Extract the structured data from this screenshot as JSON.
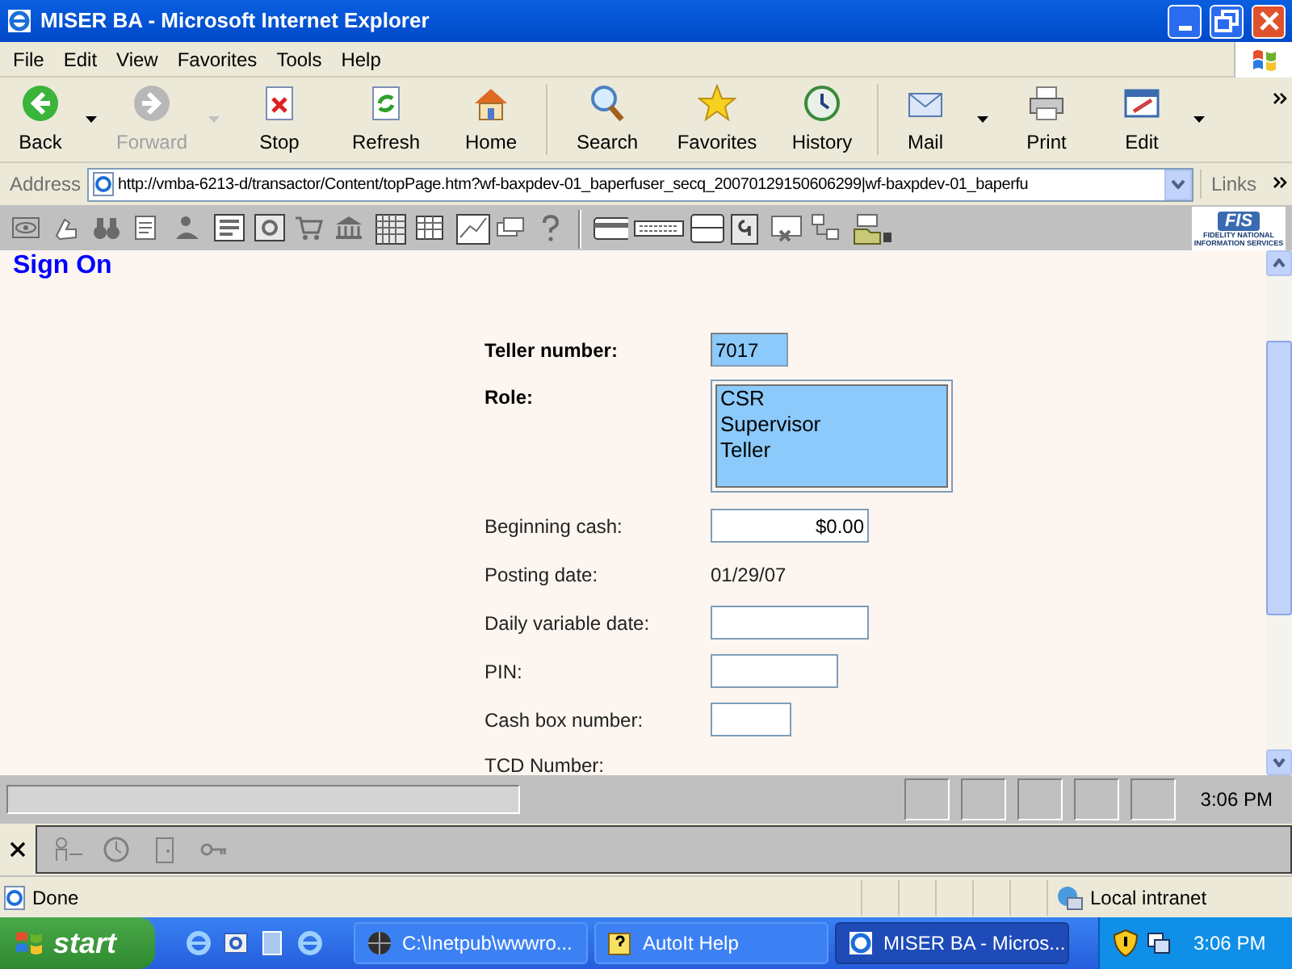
{
  "window": {
    "title": "MISER BA - Microsoft Internet Explorer"
  },
  "menu": [
    "File",
    "Edit",
    "View",
    "Favorites",
    "Tools",
    "Help"
  ],
  "toolbar": [
    {
      "kind": "back",
      "label": "Back",
      "disabled": false,
      "dropdown": true
    },
    {
      "kind": "forward",
      "label": "Forward",
      "disabled": true,
      "dropdown": true
    },
    {
      "kind": "stop",
      "label": "Stop",
      "disabled": false,
      "dropdown": false
    },
    {
      "kind": "refresh",
      "label": "Refresh",
      "disabled": false,
      "dropdown": false
    },
    {
      "kind": "home",
      "label": "Home",
      "disabled": false,
      "dropdown": false
    },
    {
      "kind": "search",
      "label": "Search",
      "disabled": false,
      "dropdown": false
    },
    {
      "kind": "favorites",
      "label": "Favorites",
      "disabled": false,
      "dropdown": false
    },
    {
      "kind": "history",
      "label": "History",
      "disabled": false,
      "dropdown": false
    },
    {
      "kind": "mail",
      "label": "Mail",
      "disabled": false,
      "dropdown": true
    },
    {
      "kind": "print",
      "label": "Print",
      "disabled": false,
      "dropdown": false
    },
    {
      "kind": "edit",
      "label": "Edit",
      "disabled": false,
      "dropdown": true
    }
  ],
  "address": {
    "label": "Address",
    "url": "http://vmba-6213-d/transactor/Content/topPage.htm?wf-baxpdev-01_baperfuser_secq_20070129150606299|wf-baxpdev-01_baperfu",
    "links": "Links"
  },
  "logo": {
    "text": "FIS",
    "tagline": [
      "FIDELITY NATIONAL",
      "INFORMATION SERVICES"
    ]
  },
  "page": {
    "heading": "Sign On",
    "fields": [
      {
        "kind": "input",
        "label": "Teller number:",
        "bold": true,
        "value": "7017",
        "highlighted": true
      },
      {
        "kind": "listbox",
        "label": "Role:",
        "bold": true,
        "options": [
          "CSR",
          "Supervisor",
          "Teller"
        ],
        "highlighted": true
      },
      {
        "kind": "input",
        "label": "Beginning cash:",
        "bold": false,
        "value": "$0.00",
        "highlighted": false
      },
      {
        "kind": "text",
        "label": "Posting date:",
        "bold": false,
        "value": "01/29/07"
      },
      {
        "kind": "input",
        "label": "Daily variable date:",
        "bold": false,
        "highlighted": false
      },
      {
        "kind": "input",
        "label": "PIN:",
        "bold": false,
        "highlighted": false
      },
      {
        "kind": "input",
        "label": "Cash box number:",
        "bold": false,
        "highlighted": false
      },
      {
        "kind": "text",
        "label": "TCD Number:",
        "bold": false
      }
    ]
  },
  "app_status": {
    "time": "3:06 PM"
  },
  "status_bar": {
    "text": "Done",
    "zone": "Local intranet"
  },
  "taskbar": {
    "start": "start",
    "tasks": [
      {
        "kind": "globe",
        "label": "C:\\Inetpub\\wwwro...",
        "selected": false
      },
      {
        "kind": "help",
        "label": "AutoIt Help",
        "selected": false
      },
      {
        "kind": "ie",
        "label": "MISER BA - Micros...",
        "selected": true
      }
    ],
    "time": "3:06 PM"
  }
}
